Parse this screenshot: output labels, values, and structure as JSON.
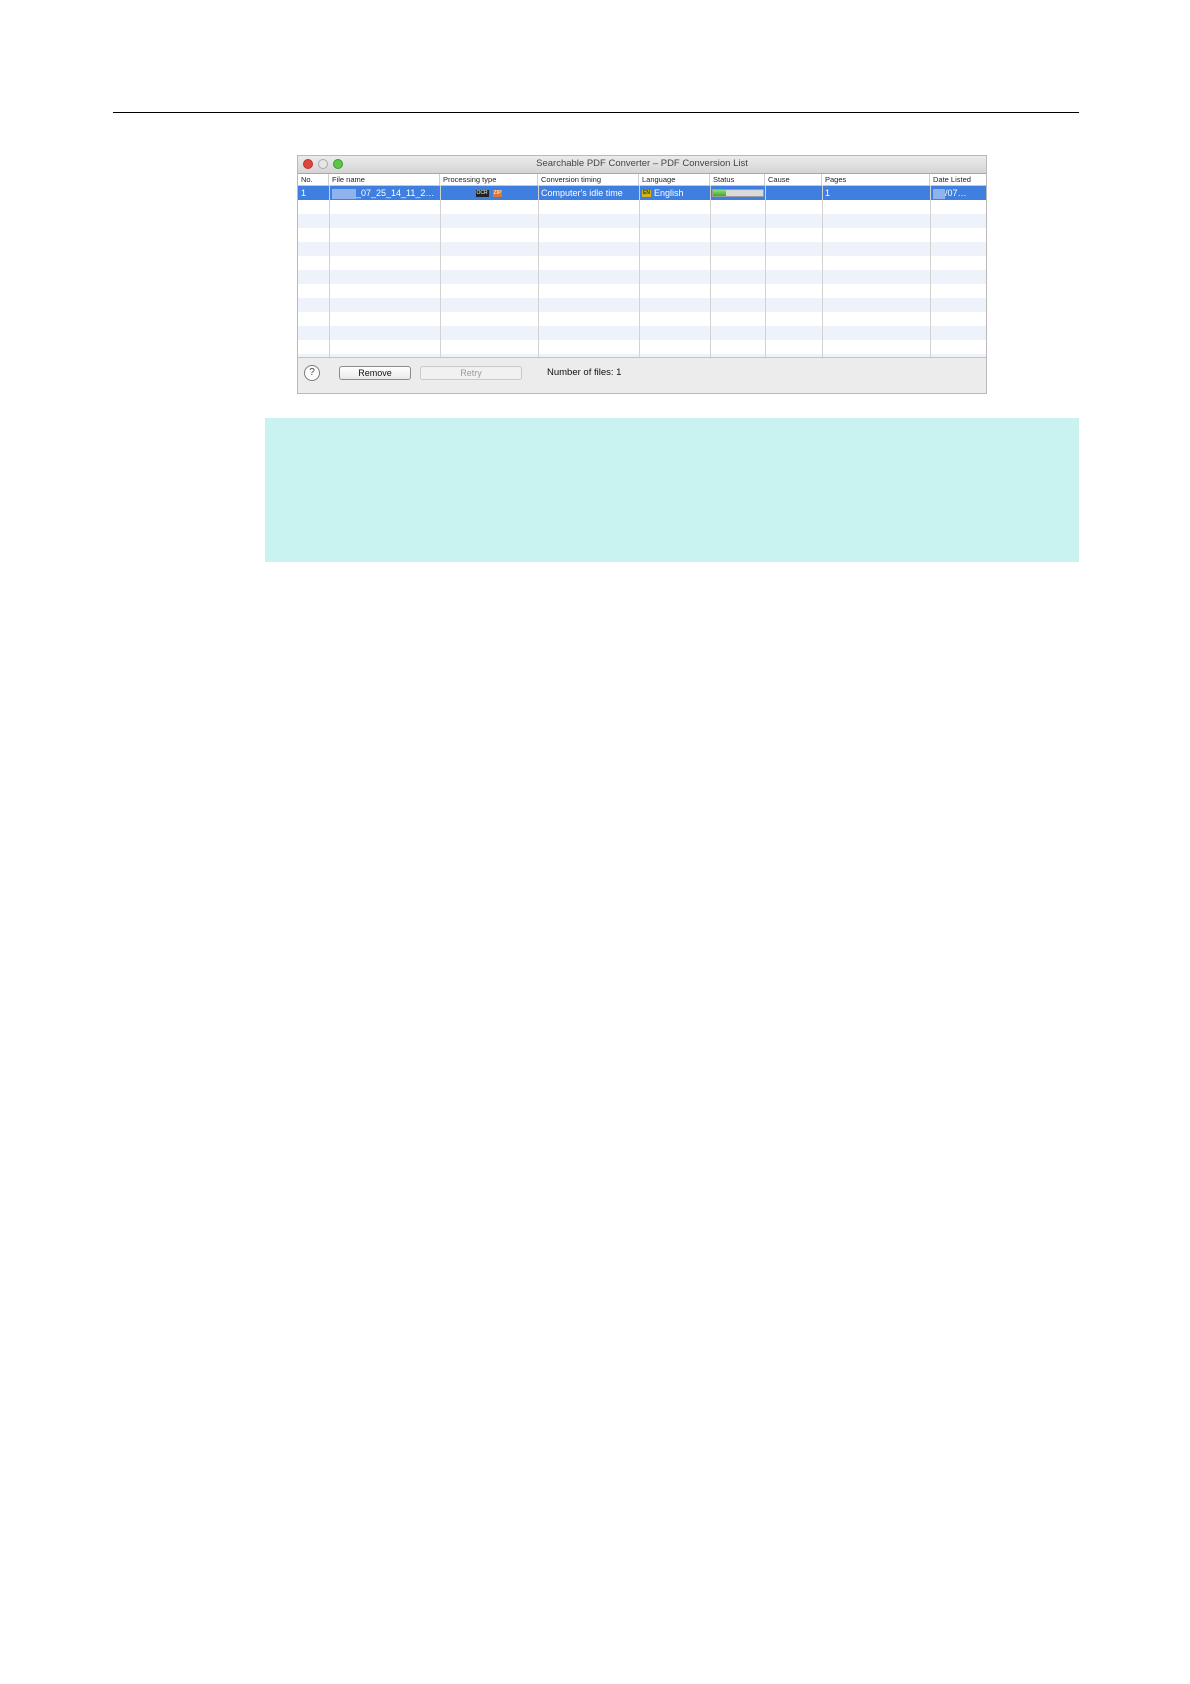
{
  "window": {
    "title": "Searchable PDF Converter – PDF Conversion List"
  },
  "columns": [
    "No.",
    "File name",
    "Processing type",
    "Conversion timing",
    "Language",
    "Status",
    "Cause",
    "Pages",
    "Date Listed"
  ],
  "selected_row": {
    "no": "1",
    "file_name": "_07_25_14_11_2…",
    "processing_icons": [
      "ocr-icon",
      "zip-icon"
    ],
    "conversion_timing": "Computer's idle time",
    "language_badge": "EN",
    "language": "English",
    "status_progress_fraction": 0.25,
    "cause": "",
    "pages": "1",
    "date_listed": "/07…"
  },
  "footer": {
    "help_label": "?",
    "remove_label": "Remove",
    "retry_label": "Retry",
    "file_count_text": "Number of files: 1"
  },
  "colors": {
    "selection": "#3f7fe0",
    "note_background": "#c9f3f0",
    "progress_fill": "#3daa25"
  }
}
